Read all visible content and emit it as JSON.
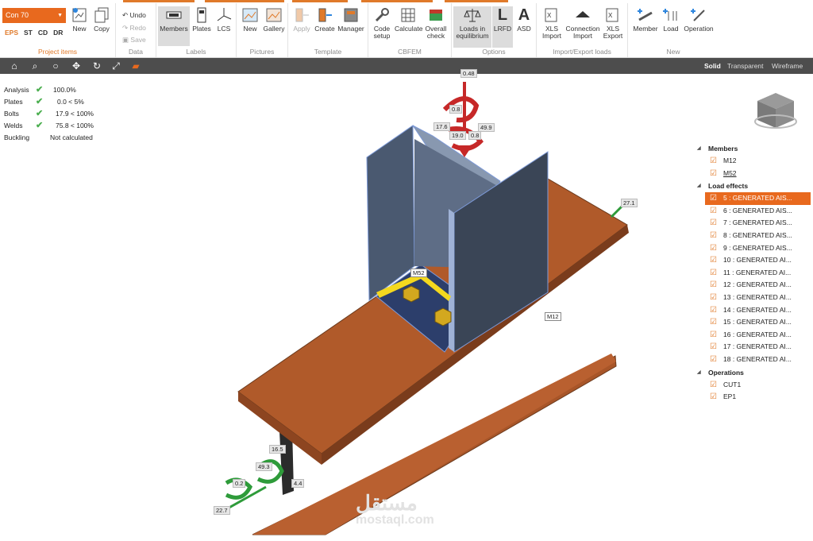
{
  "ribbon": {
    "project_select": "Con 70",
    "code_tabs": [
      "EPS",
      "ST",
      "CD",
      "DR"
    ],
    "groups": {
      "project_items": {
        "title": "Project items",
        "new": "New",
        "copy": "Copy"
      },
      "data": {
        "title": "Data",
        "undo": "Undo",
        "redo": "Redo",
        "save": "Save"
      },
      "labels": {
        "title": "Labels",
        "members": "Members",
        "plates": "Plates",
        "lcs": "LCS"
      },
      "pictures": {
        "title": "Pictures",
        "new": "New",
        "gallery": "Gallery"
      },
      "template": {
        "title": "Template",
        "apply": "Apply",
        "create": "Create",
        "manager": "Manager"
      },
      "cbfem": {
        "title": "CBFEM",
        "code_setup_1": "Code",
        "code_setup_2": "setup",
        "calculate": "Calculate",
        "overall_check_1": "Overall",
        "overall_check_2": "check"
      },
      "options": {
        "title": "Options",
        "loads_eq_1": "Loads in",
        "loads_eq_2": "equilibrium",
        "lrfd": "LRFD",
        "asd": "ASD"
      },
      "import_export": {
        "title": "Import/Export loads",
        "xls_import_1": "XLS",
        "xls_import_2": "Import",
        "conn_import_1": "Connection",
        "conn_import_2": "Import",
        "xls_export_1": "XLS",
        "xls_export_2": "Export"
      },
      "new": {
        "title": "New",
        "member": "Member",
        "load": "Load",
        "operation": "Operation"
      }
    }
  },
  "view_modes": [
    "Solid",
    "Transparent",
    "Wireframe"
  ],
  "selected_view_mode": "Solid",
  "status": [
    {
      "label": "Analysis",
      "value": "100.0%",
      "check": true
    },
    {
      "label": "Plates",
      "value": "0.0 < 5%",
      "check": true
    },
    {
      "label": "Bolts",
      "value": "17.9 < 100%",
      "check": true
    },
    {
      "label": "Welds",
      "value": "75.8 < 100%",
      "check": true
    },
    {
      "label": "Buckling",
      "value": "Not calculated",
      "check": false
    }
  ],
  "tree": {
    "members_title": "Members",
    "members": [
      "M12",
      "M52"
    ],
    "load_effects_title": "Load effects",
    "load_effects": [
      "5 : GENERATED AIS...",
      "6 : GENERATED AIS...",
      "7 : GENERATED AIS...",
      "8 : GENERATED AIS...",
      "9 : GENERATED AIS...",
      "10 : GENERATED AI...",
      "11 : GENERATED AI...",
      "12 : GENERATED AI...",
      "13 : GENERATED AI...",
      "14 : GENERATED AI...",
      "15 : GENERATED AI...",
      "16 : GENERATED AI...",
      "17 : GENERATED AI...",
      "18 : GENERATED AI..."
    ],
    "operations_title": "Operations",
    "operations": [
      "CUT1",
      "EP1"
    ]
  },
  "scene_labels": {
    "m52": "M52",
    "m12": "M12",
    "top_cut": "0.48",
    "top_moment": "0.8",
    "v1": "17.6",
    "v2": "49.9",
    "v3": "19.0",
    "v4": "0.8",
    "right_force": "27.1",
    "end_1": "16.5",
    "end_2": "49.3",
    "end_3": "0.2",
    "end_4": "4.4",
    "end_5": "22.7"
  },
  "watermark": {
    "arabic": "مستقل",
    "latin": "mostaql.com"
  }
}
